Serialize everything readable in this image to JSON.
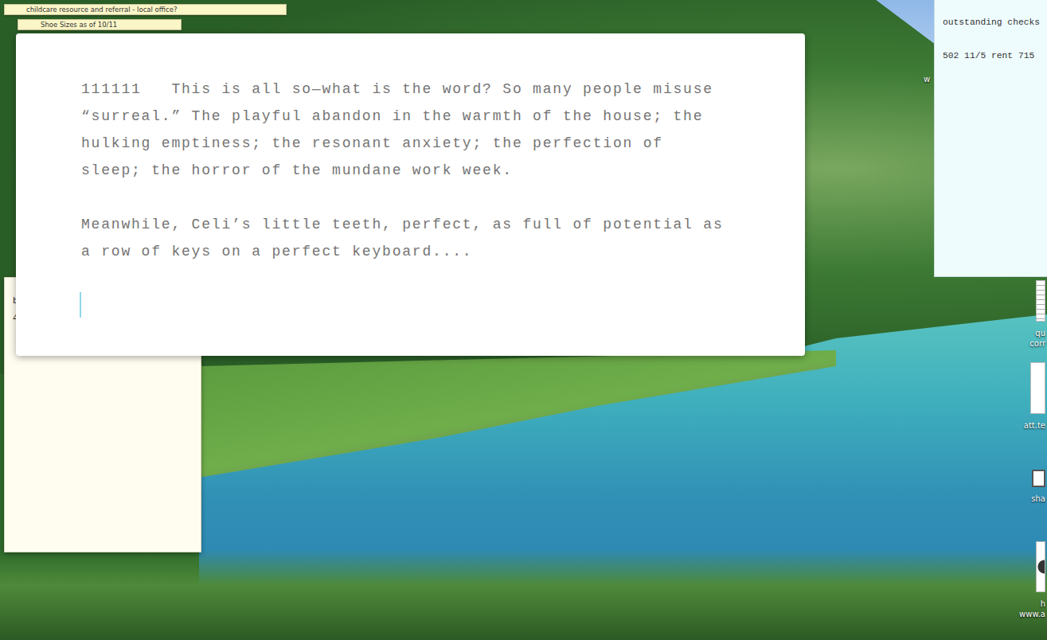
{
  "desktop": {
    "wallpaper": "photo"
  },
  "stickies": [
    {
      "text": "childcare resource and referral - local office?"
    },
    {
      "text": "Shoe Sizes as of 10/11"
    }
  ],
  "editor": {
    "paragraphs": [
      "111111   This is all so—what is the word? So many people misuse “surreal.” The playful abandon in the warmth of the house; the hulking emptiness; the resonant anxiety; the perfection of sleep; the horror of the mundane work week.",
      "Meanwhile, Celi’s little teeth, perfect, as full of potential as a row of keys on a perfect keyboard...."
    ],
    "caret_visible": true
  },
  "back_note": {
    "lines": [
      "b",
      "4"
    ]
  },
  "checks_note": {
    "title": "outstanding checks",
    "lines": [
      "502 11/5 rent 715"
    ]
  },
  "desktop_icons": [
    {
      "lines": [
        "w"
      ],
      "icon": false
    },
    {
      "lines": [
        "qu",
        "corr"
      ],
      "icon": true
    },
    {
      "lines": [
        "att.te"
      ],
      "icon": true
    },
    {
      "lines": [
        "sha"
      ],
      "icon": true
    },
    {
      "lines": [
        "h",
        "www.a"
      ],
      "icon": true
    }
  ]
}
